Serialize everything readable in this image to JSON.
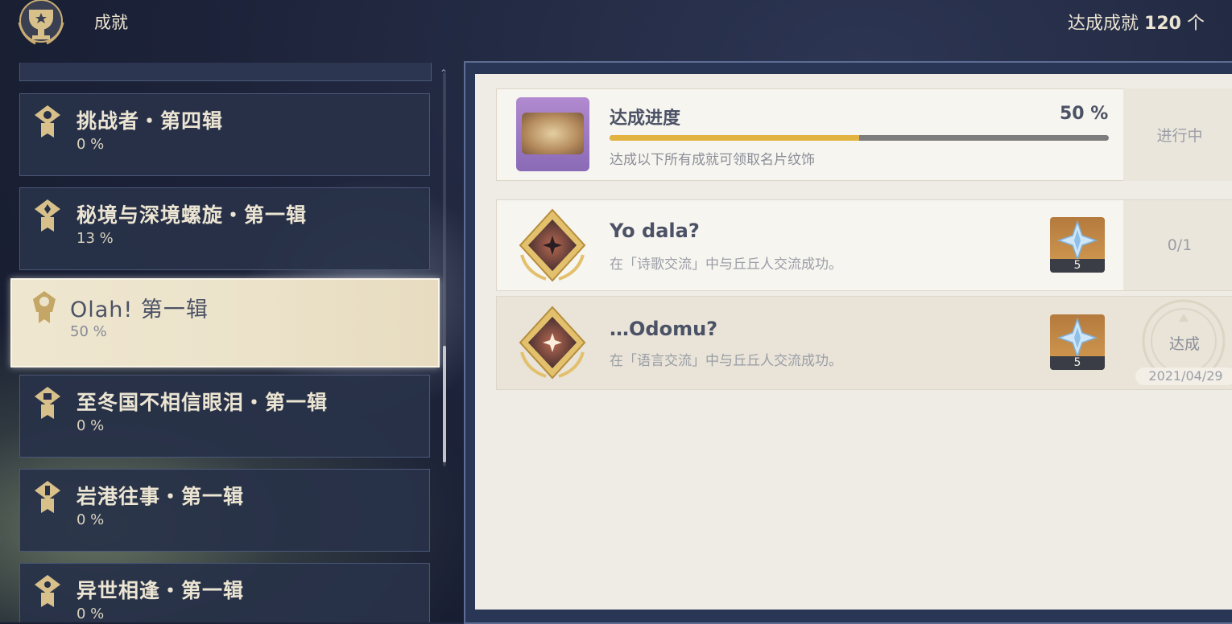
{
  "header": {
    "title": "成就",
    "count_label": "达成成就",
    "count_value": "120",
    "count_unit": "个"
  },
  "categories": [
    {
      "name": "挑战者・第四辑",
      "pct": "0 %",
      "active": false
    },
    {
      "name": "秘境与深境螺旋・第一辑",
      "pct": "13 %",
      "active": false
    },
    {
      "name": "Olah! 第一辑",
      "pct": "50 %",
      "active": true
    },
    {
      "name": "至冬国不相信眼泪・第一辑",
      "pct": "0 %",
      "active": false
    },
    {
      "name": "岩港往事・第一辑",
      "pct": "0 %",
      "active": false
    },
    {
      "name": "异世相逢・第一辑",
      "pct": "0 %",
      "active": false
    }
  ],
  "progress": {
    "label": "达成进度",
    "pct_text": "50 %",
    "fraction": 0.5,
    "desc": "达成以下所有成就可领取名片纹饰",
    "status": "进行中"
  },
  "achievements": [
    {
      "title": "Yo dala?",
      "desc": "在「诗歌交流」中与丘丘人交流成功。",
      "reward_qty": "5",
      "status": "0/1",
      "done": false
    },
    {
      "title": "…Odomu?",
      "desc": "在「语言交流」中与丘丘人交流成功。",
      "reward_qty": "5",
      "status": "达成",
      "date": "2021/04/29",
      "done": true
    }
  ],
  "colors": {
    "accent": "#e3b341",
    "panel": "#efece5",
    "sidebar_item": "#283148"
  }
}
